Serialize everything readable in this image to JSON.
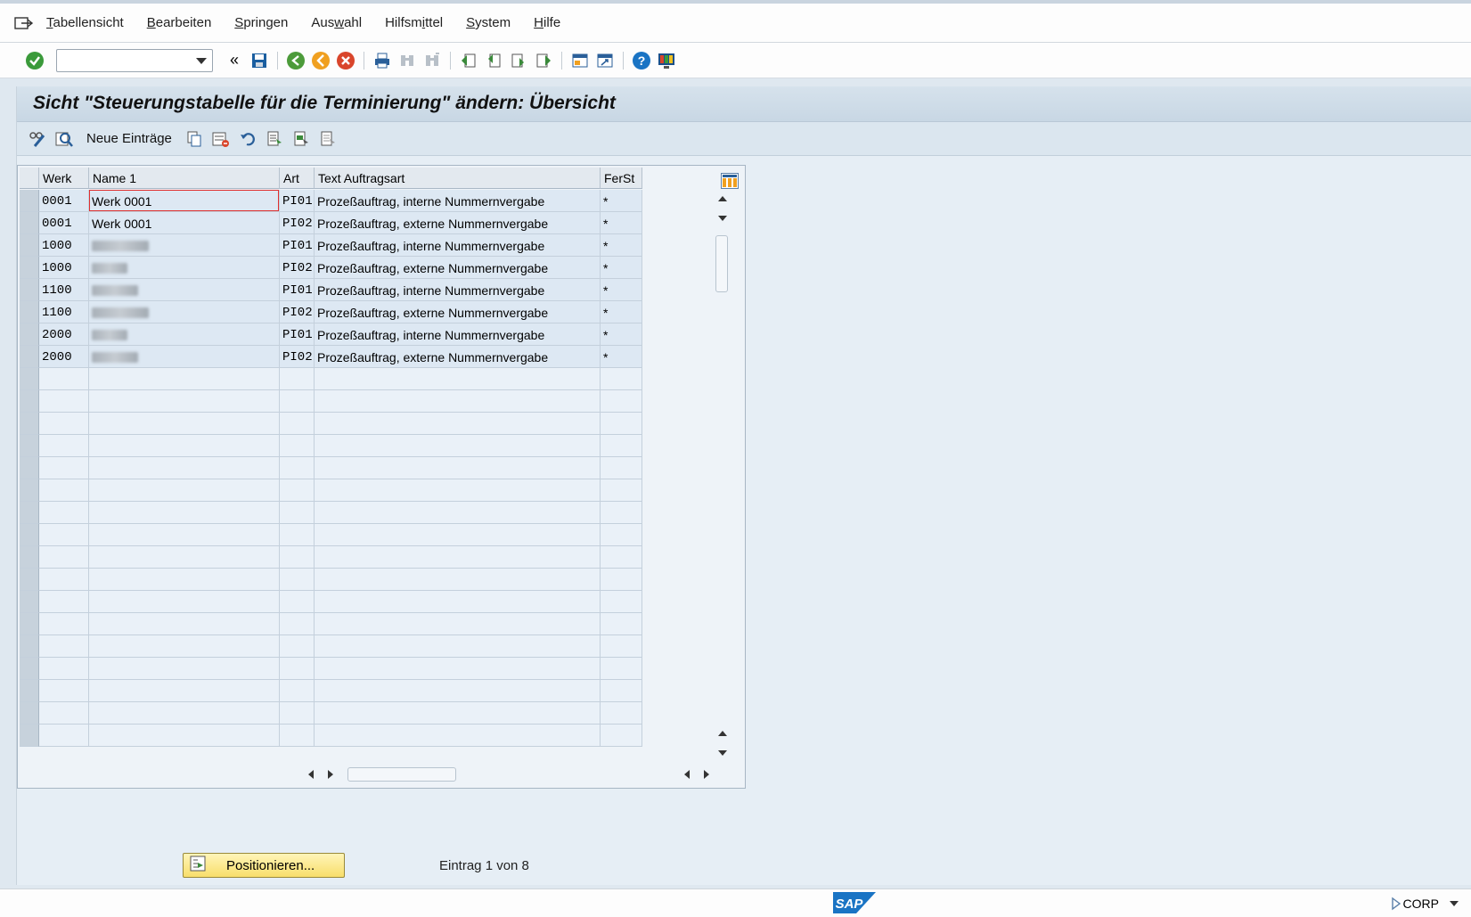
{
  "menu": [
    "Tabellensicht",
    "Bearbeiten",
    "Springen",
    "Auswahl",
    "Hilfsmittel",
    "System",
    "Hilfe"
  ],
  "menu_mnemonic": [
    0,
    0,
    0,
    3,
    6,
    0,
    0
  ],
  "toolbar": {
    "command_value": ""
  },
  "title": "Sicht \"Steuerungstabelle für die Terminierung\" ändern: Übersicht",
  "app_toolbar": {
    "new_entries": "Neue Einträge"
  },
  "table": {
    "columns": [
      "Werk",
      "Name 1",
      "Art",
      "Text Auftragsart",
      "FerSt"
    ],
    "rows": [
      {
        "werk": "0001",
        "name": "Werk 0001",
        "art": "PI01",
        "text": "Prozeßauftrag, interne Nummernvergabe",
        "ferst": "*"
      },
      {
        "werk": "0001",
        "name": "Werk 0001",
        "art": "PI02",
        "text": "Prozeßauftrag, externe Nummernvergabe",
        "ferst": "*"
      },
      {
        "werk": "1000",
        "name": "",
        "art": "PI01",
        "text": "Prozeßauftrag, interne Nummernvergabe",
        "ferst": "*"
      },
      {
        "werk": "1000",
        "name": "",
        "art": "PI02",
        "text": "Prozeßauftrag, externe Nummernvergabe",
        "ferst": "*"
      },
      {
        "werk": "1100",
        "name": "",
        "art": "PI01",
        "text": "Prozeßauftrag, interne Nummernvergabe",
        "ferst": "*"
      },
      {
        "werk": "1100",
        "name": "",
        "art": "PI02",
        "text": "Prozeßauftrag, externe Nummernvergabe",
        "ferst": "*"
      },
      {
        "werk": "2000",
        "name": "",
        "art": "PI01",
        "text": "Prozeßauftrag, interne Nummernvergabe",
        "ferst": "*"
      },
      {
        "werk": "2000",
        "name": "",
        "art": "PI02",
        "text": "Prozeßauftrag, externe Nummernvergabe",
        "ferst": "*"
      }
    ],
    "blurred_names": [
      false,
      false,
      true,
      true,
      true,
      true,
      true,
      true
    ],
    "empty_rows": 17
  },
  "footer": {
    "position_button": "Positionieren...",
    "entry_info": "Eintrag 1 von 8"
  },
  "status": {
    "system": "CORP",
    "logo": "SAP"
  },
  "colors": {
    "accent_green": "#3a9a3a",
    "brand_blue": "#1a74c4",
    "button_yellow": "#f8de6a"
  }
}
